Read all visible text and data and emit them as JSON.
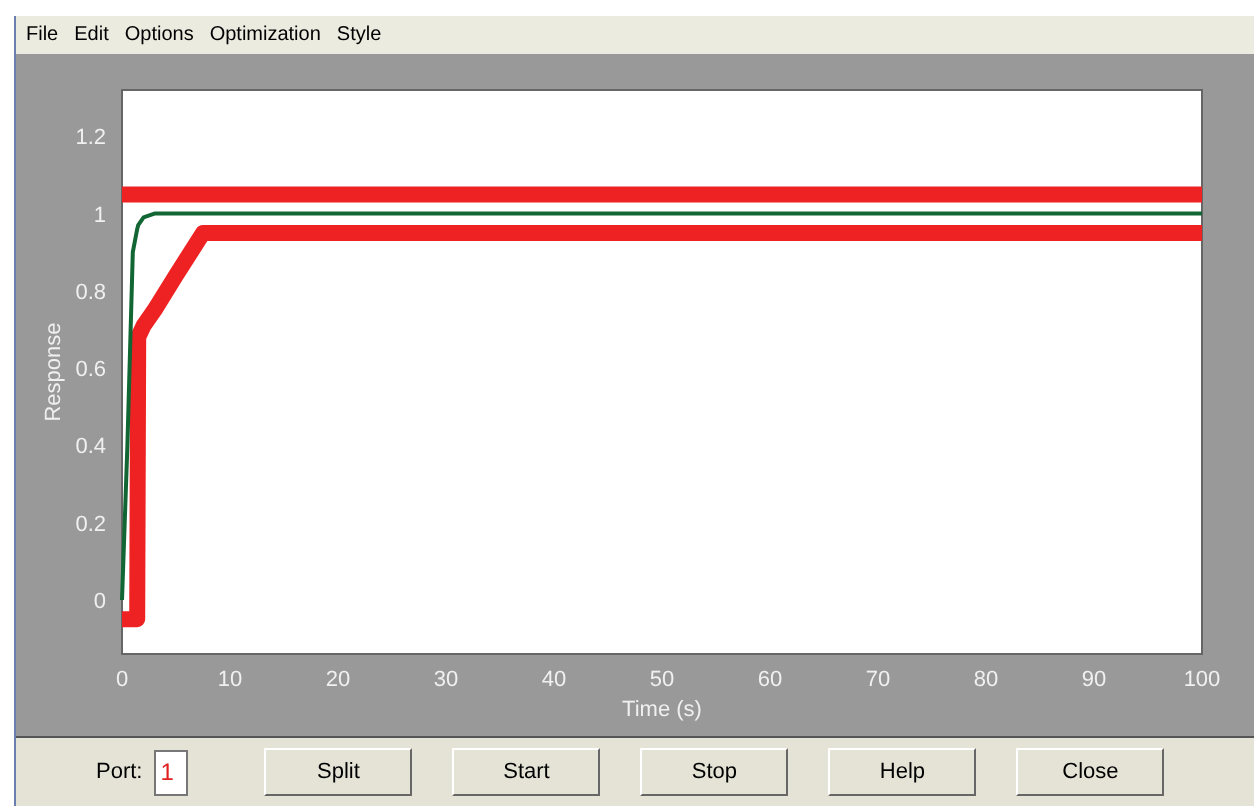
{
  "menu": [
    "File",
    "Edit",
    "Options",
    "Optimization",
    "Style"
  ],
  "chart": {
    "chart_data": {
      "type": "line",
      "xlabel": "Time (s)",
      "ylabel": "Response",
      "x": [
        0,
        0.5,
        1,
        1.4,
        1.5,
        2,
        3,
        5,
        7.5,
        10,
        30,
        100
      ],
      "series": [
        {
          "color": "#ee2222",
          "values": [
            1.05,
            1.05,
            1.05,
            1.05,
            1.05,
            1.05,
            1.05,
            1.05,
            1.05,
            1.05,
            1.05,
            1.05
          ]
        },
        {
          "color": "#ee2222",
          "values": [
            -0.05,
            -0.05,
            -0.05,
            -0.05,
            0.68,
            0.71,
            0.75,
            0.84,
            0.95,
            0.95,
            0.95,
            0.95
          ]
        },
        {
          "color": "#116633",
          "values": [
            0,
            0.4,
            0.9,
            0.96,
            0.97,
            0.99,
            1,
            1,
            1,
            1,
            1,
            1
          ]
        }
      ],
      "xlim": [
        0,
        100
      ],
      "ylim": [
        -0.14,
        1.32
      ],
      "xticks": [
        0,
        10,
        20,
        30,
        40,
        50,
        60,
        70,
        80,
        90,
        100
      ],
      "yticks": [
        0,
        0.2,
        0.4,
        0.6,
        0.8,
        1,
        1.2
      ]
    }
  },
  "port": {
    "label": "Port:",
    "value": "1"
  },
  "buttons": [
    "Split",
    "Start",
    "Stop",
    "Help",
    "Close"
  ]
}
